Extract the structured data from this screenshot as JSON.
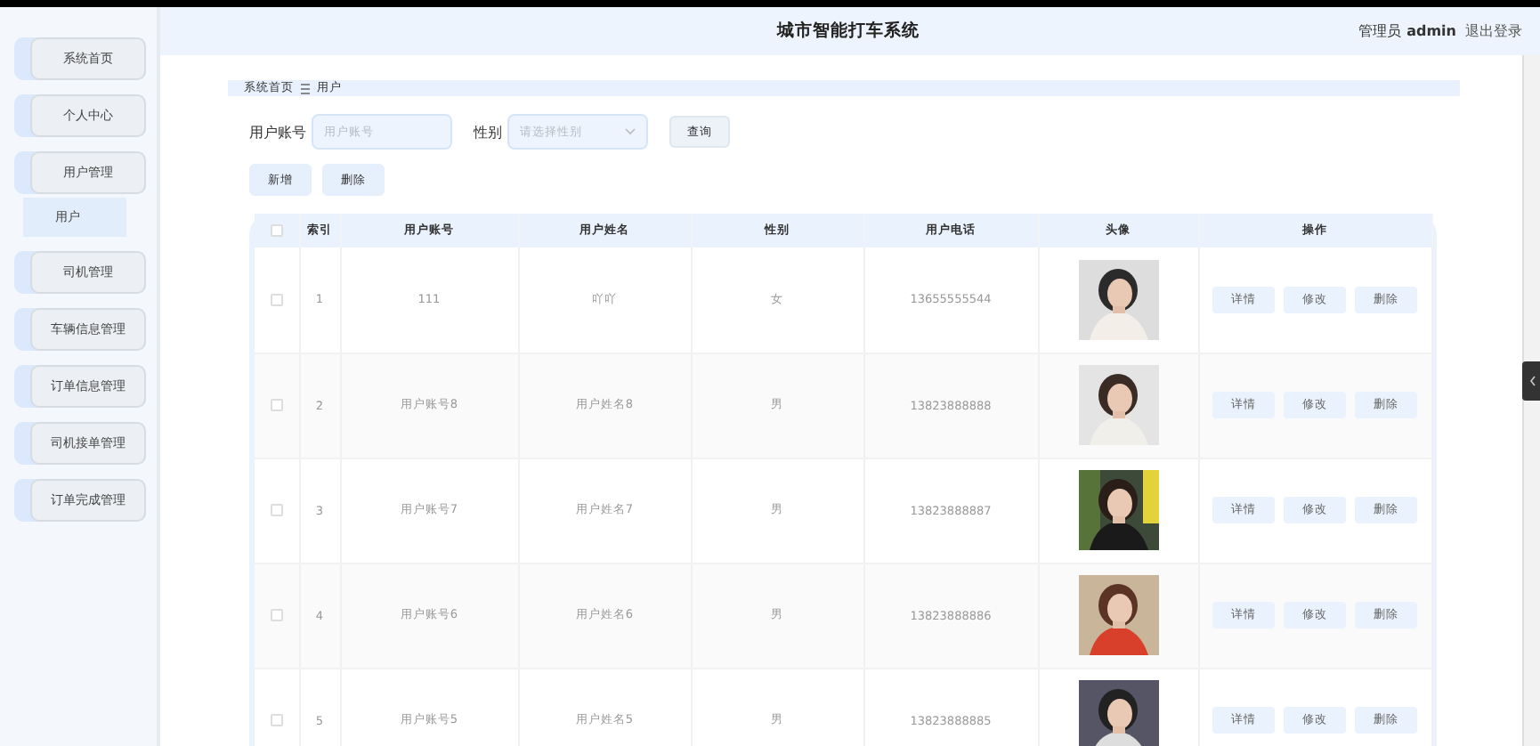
{
  "header": {
    "title": "城市智能打车系统",
    "role": "管理员",
    "username": "admin",
    "logout": "退出登录"
  },
  "sidebar": {
    "items": [
      {
        "label": "系统首页",
        "selected": false
      },
      {
        "label": "个人中心",
        "selected": false
      },
      {
        "label": "用户管理",
        "selected": false,
        "children": [
          {
            "label": "用户",
            "selected": true
          }
        ]
      },
      {
        "label": "司机管理",
        "selected": false
      },
      {
        "label": "车辆信息管理",
        "selected": false
      },
      {
        "label": "订单信息管理",
        "selected": false
      },
      {
        "label": "司机接单管理",
        "selected": false
      },
      {
        "label": "订单完成管理",
        "selected": false
      }
    ]
  },
  "breadcrumb": [
    "系统首页",
    "用户"
  ],
  "search": {
    "account_label": "用户账号",
    "account_placeholder": "用户账号",
    "gender_label": "性别",
    "gender_placeholder": "请选择性别",
    "query_button": "查询"
  },
  "actions": [
    "新增",
    "删除"
  ],
  "table": {
    "all_checked": false,
    "columns": [
      "索引",
      "用户账号",
      "用户姓名",
      "性别",
      "用户电话",
      "头像",
      "操作"
    ],
    "rows": [
      {
        "checked": false,
        "cells": [
          "1",
          "111",
          "吖吖",
          "女",
          "13655555544"
        ],
        "buttons": [
          "详情",
          "修改",
          "删除"
        ]
      },
      {
        "checked": false,
        "cells": [
          "2",
          "用户账号8",
          "用户姓名8",
          "男",
          "13823888888"
        ],
        "buttons": [
          "详情",
          "修改",
          "删除"
        ]
      },
      {
        "checked": false,
        "cells": [
          "3",
          "用户账号7",
          "用户姓名7",
          "男",
          "13823888887"
        ],
        "buttons": [
          "详情",
          "修改",
          "删除"
        ]
      },
      {
        "checked": false,
        "cells": [
          "4",
          "用户账号6",
          "用户姓名6",
          "男",
          "13823888886"
        ],
        "buttons": [
          "详情",
          "修改",
          "删除"
        ]
      },
      {
        "checked": false,
        "cells": [
          "5",
          "用户账号5",
          "用户姓名5",
          "男",
          "13823888885"
        ],
        "buttons": [
          "详情",
          "修改",
          "删除"
        ]
      }
    ]
  }
}
